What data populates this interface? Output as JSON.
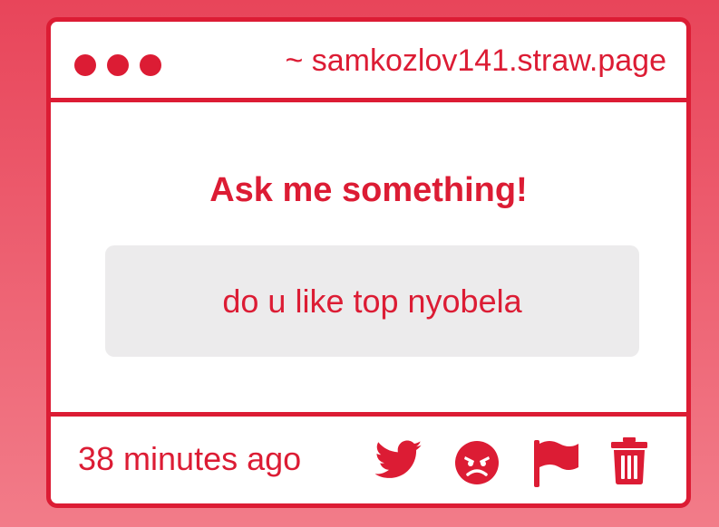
{
  "titlebar": {
    "url": "~ samkozlov141.straw.page"
  },
  "main": {
    "heading": "Ask me something!",
    "question": "do u like top nyobela"
  },
  "footer": {
    "timestamp": "38 minutes ago",
    "actions": [
      {
        "icon": "twitter-icon"
      },
      {
        "icon": "angry-face-icon"
      },
      {
        "icon": "flag-icon"
      },
      {
        "icon": "trash-icon"
      }
    ]
  },
  "colors": {
    "accent": "#dc1c34",
    "background_top": "#e8455a",
    "background_bottom": "#f27c89",
    "question_box": "#ecebec"
  }
}
